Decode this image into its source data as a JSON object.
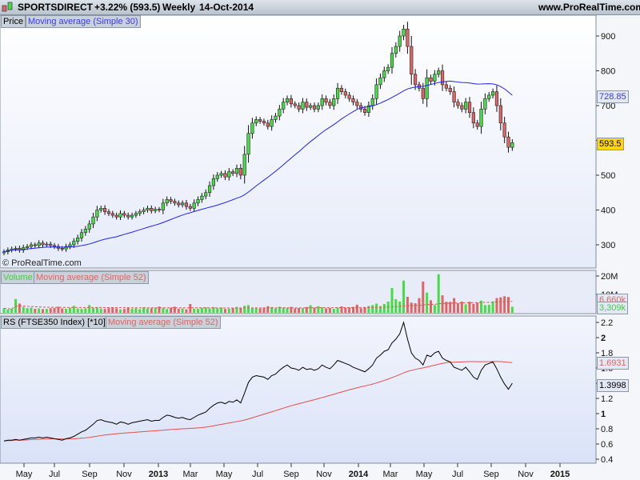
{
  "header": {
    "symbol": "SPORTSDIRECT",
    "change": "+3.22% (593.5)",
    "period": "Weekly",
    "date": "14-Oct-2014",
    "site": "www.ProRealTime.com"
  },
  "watermark": "© ProRealTime.com",
  "colors": {
    "up": "#44dd44",
    "down": "#e06464",
    "ma_price": "#2222ee",
    "ma_red": "#e05050",
    "last_price_box": "#ffd700"
  },
  "chart_data": [
    {
      "type": "candlestick",
      "panel": "price",
      "title": "Price",
      "indicator": "Moving average (Simple 30)",
      "yticks": [
        300,
        400,
        500,
        600,
        700,
        800,
        900
      ],
      "ylim": [
        260,
        940
      ],
      "last_value": "593.5",
      "ma_last_value": "728.85",
      "close": [
        280,
        285,
        288,
        290,
        285,
        292,
        295,
        300,
        298,
        305,
        300,
        302,
        298,
        295,
        290,
        288,
        295,
        300,
        310,
        320,
        335,
        345,
        360,
        380,
        400,
        405,
        395,
        390,
        385,
        380,
        390,
        385,
        380,
        385,
        390,
        395,
        400,
        405,
        398,
        402,
        400,
        420,
        430,
        425,
        420,
        415,
        420,
        410,
        405,
        420,
        430,
        440,
        450,
        470,
        490,
        500,
        505,
        495,
        510,
        505,
        520,
        500,
        560,
        620,
        650,
        660,
        655,
        650,
        640,
        660,
        670,
        690,
        710,
        720,
        705,
        700,
        690,
        710,
        695,
        700,
        690,
        700,
        720,
        710,
        700,
        720,
        750,
        740,
        730,
        720,
        710,
        700,
        690,
        680,
        700,
        720,
        760,
        780,
        800,
        810,
        850,
        870,
        900,
        920,
        870,
        790,
        760,
        750,
        720,
        780,
        770,
        790,
        800,
        760,
        750,
        740,
        710,
        700,
        690,
        710,
        680,
        650,
        640,
        690,
        720,
        730,
        740,
        700,
        650,
        610,
        580,
        593.5
      ]
    },
    {
      "type": "bar",
      "panel": "volume",
      "title": "Volume",
      "indicator": "Moving average (Simple 52)",
      "unit": "M",
      "yticks": [
        "20M",
        "10M"
      ],
      "ylim": [
        0,
        22
      ],
      "last_value": "3,309k",
      "ma_last_value": "6,660k",
      "values": [
        2.5,
        1.8,
        2.2,
        7.5,
        5,
        3.2,
        2.6,
        2.8,
        2.2,
        2.4,
        2,
        2.1,
        2.5,
        2.6,
        3.3,
        2.4,
        2.2,
        2.6,
        3.8,
        2.3,
        2.1,
        2.4,
        4.2,
        2.6,
        3,
        2.3,
        2.1,
        2.5,
        2.8,
        2.4,
        1.8,
        2.1,
        2.6,
        2.2,
        2.4,
        2,
        3,
        2.4,
        2.5,
        2.8,
        3.4,
        2.6,
        2.1,
        2.8,
        3.3,
        2.2,
        2.4,
        1.9,
        4.8,
        2.3,
        2.2,
        2.7,
        3,
        2.4,
        3.1,
        2.5,
        2.9,
        2.1,
        2.2,
        2.6,
        3.2,
        2.7,
        3.8,
        4.2,
        2.4,
        2.6,
        2.3,
        2.8,
        3.6,
        3.1,
        2.4,
        3.3,
        2.8,
        2.6,
        3.2,
        2.4,
        2.6,
        2.5,
        3.1,
        4.1,
        2.8,
        3.6,
        3,
        2.4,
        2.6,
        2.2,
        2.8,
        3.5,
        2.7,
        2.9,
        3.2,
        4.4,
        2.5,
        3.1,
        3.7,
        4.2,
        5,
        3.6,
        4.8,
        6.1,
        13.5,
        7.4,
        6.2,
        17.5,
        8.7,
        5.5,
        5.2,
        8,
        17,
        11,
        6.8,
        4.2,
        21,
        9.5,
        6,
        6,
        8,
        5.2,
        6.1,
        4.6,
        6,
        4.8,
        5.5,
        6.6,
        4.2,
        4.4,
        6.2,
        8,
        8.4,
        9,
        8.6,
        3.3
      ]
    },
    {
      "type": "line",
      "panel": "rs",
      "title": "RS (FTSE350 Index) [*10]",
      "indicator": "Moving average (Simple 52)",
      "yticks": [
        0.4,
        0.6,
        0.8,
        1,
        1.2,
        1.4,
        1.6,
        1.8,
        2,
        2.2
      ],
      "ylim": [
        0.35,
        2.3
      ],
      "last_value": "1.3998",
      "ma_last_value": "1.6931",
      "values": [
        0.64,
        0.65,
        0.65,
        0.66,
        0.65,
        0.66,
        0.67,
        0.68,
        0.68,
        0.69,
        0.68,
        0.69,
        0.68,
        0.67,
        0.66,
        0.65,
        0.67,
        0.68,
        0.7,
        0.73,
        0.76,
        0.78,
        0.82,
        0.86,
        0.91,
        0.92,
        0.9,
        0.89,
        0.88,
        0.86,
        0.89,
        0.88,
        0.86,
        0.88,
        0.89,
        0.9,
        0.91,
        0.92,
        0.9,
        0.91,
        0.91,
        0.95,
        0.98,
        0.97,
        0.95,
        0.94,
        0.95,
        0.93,
        0.92,
        0.95,
        0.98,
        1.0,
        1.02,
        1.07,
        1.11,
        1.14,
        1.15,
        1.13,
        1.16,
        1.15,
        1.18,
        1.14,
        1.27,
        1.41,
        1.48,
        1.5,
        1.49,
        1.48,
        1.45,
        1.5,
        1.52,
        1.57,
        1.61,
        1.64,
        1.6,
        1.59,
        1.57,
        1.61,
        1.58,
        1.59,
        1.57,
        1.59,
        1.64,
        1.61,
        1.59,
        1.64,
        1.7,
        1.68,
        1.66,
        1.64,
        1.61,
        1.59,
        1.57,
        1.55,
        1.59,
        1.64,
        1.73,
        1.77,
        1.82,
        1.84,
        1.93,
        1.98,
        2.05,
        2.2,
        1.98,
        1.8,
        1.73,
        1.7,
        1.64,
        1.77,
        1.75,
        1.8,
        1.82,
        1.73,
        1.7,
        1.68,
        1.61,
        1.59,
        1.57,
        1.61,
        1.55,
        1.48,
        1.45,
        1.57,
        1.64,
        1.66,
        1.68,
        1.59,
        1.48,
        1.39,
        1.32,
        1.3998
      ]
    }
  ],
  "xaxis": {
    "labels": [
      "May",
      "Jul",
      "Sep",
      "Nov",
      "2013",
      "Mar",
      "May",
      "Jul",
      "Sep",
      "Nov",
      "2014",
      "Mar",
      "May",
      "Jul",
      "Sep",
      "Nov",
      "2015"
    ],
    "bold": [
      "2013",
      "2014",
      "2015"
    ]
  }
}
